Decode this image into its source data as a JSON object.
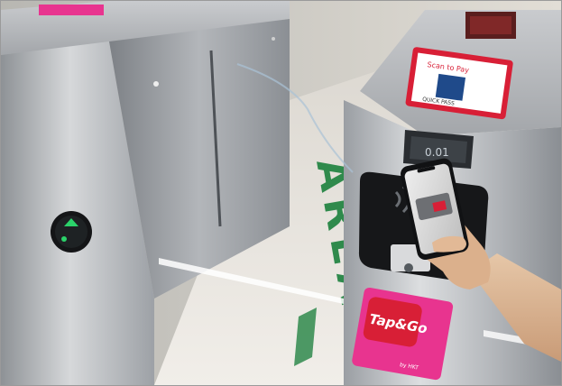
{
  "photo": {
    "floor_text": "AREA",
    "gate_display": "0.01",
    "sticker_brand": "Tap&Go",
    "sticker_sub": "by HKT",
    "sign_title": "Scan to Pay",
    "sign_sub": "QUICK PASS"
  },
  "colors": {
    "steel": "#b9bcc0",
    "steel_dark": "#6f7378",
    "floor_green": "#2f8a4c",
    "sticker_magenta": "#e8348f",
    "sticker_red": "#d81f36",
    "indicator_green": "#2bd36a"
  },
  "icons": {
    "contactless": "contactless-icon",
    "phone": "smartphone-icon"
  }
}
